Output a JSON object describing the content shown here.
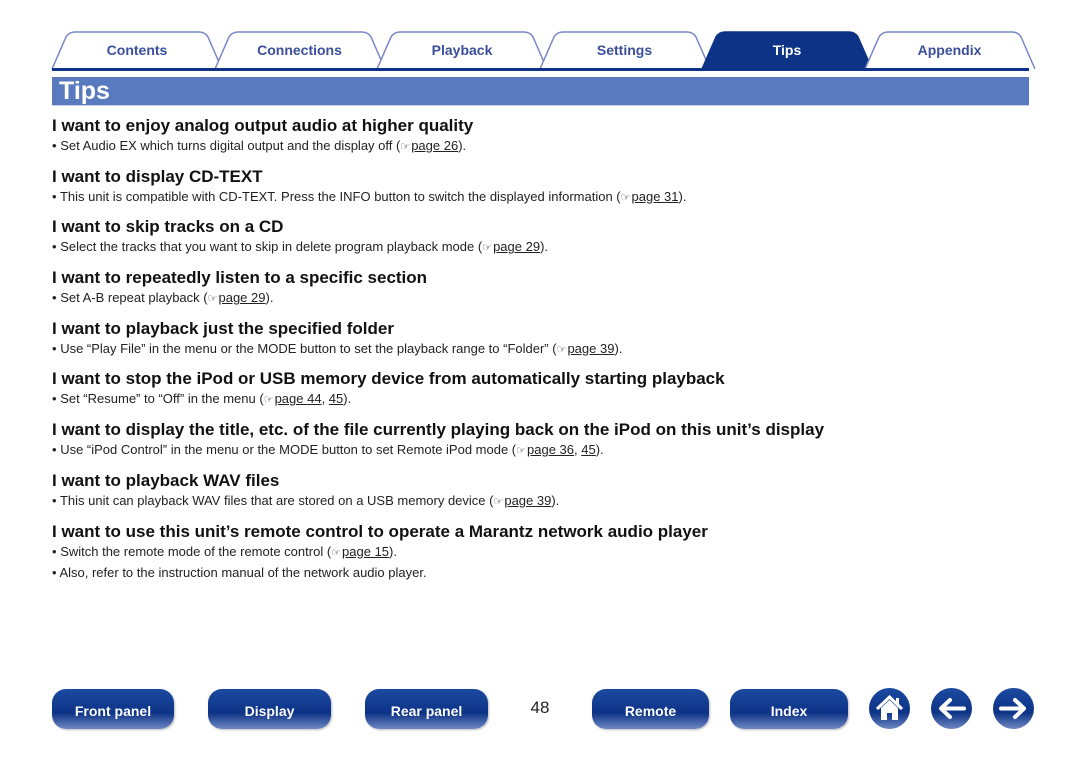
{
  "tabs": [
    {
      "label": "Contents"
    },
    {
      "label": "Connections"
    },
    {
      "label": "Playback"
    },
    {
      "label": "Settings"
    },
    {
      "label": "Tips",
      "active": true
    },
    {
      "label": "Appendix"
    }
  ],
  "title": "Tips",
  "sections": [
    {
      "heading": "I want to enjoy analog output audio at higher quality",
      "bullets": [
        {
          "pre": "Set Audio EX which turns digital output and the display off (",
          "links": [
            "page 26"
          ],
          "post": ")."
        }
      ]
    },
    {
      "heading": "I want to display CD-TEXT",
      "bullets": [
        {
          "pre": "This unit is compatible with CD-TEXT. Press the INFO button to switch the displayed information (",
          "links": [
            "page 31"
          ],
          "post": ")."
        }
      ]
    },
    {
      "heading": "I want to skip tracks on a CD",
      "bullets": [
        {
          "pre": "Select the tracks that you want to skip in delete program playback mode (",
          "links": [
            "page 29"
          ],
          "post": ")."
        }
      ]
    },
    {
      "heading": "I want to repeatedly listen to a specific section",
      "bullets": [
        {
          "pre": "Set A-B repeat playback (",
          "links": [
            "page 29"
          ],
          "post": ")."
        }
      ]
    },
    {
      "heading": "I want to playback just the specified folder",
      "bullets": [
        {
          "pre": "Use “Play File” in the menu or the MODE button to set the playback range to “Folder” (",
          "links": [
            "page 39"
          ],
          "post": ")."
        }
      ]
    },
    {
      "heading": "I want to stop the iPod or USB memory device from automatically starting playback",
      "bullets": [
        {
          "pre": "Set “Resume” to “Off” in the menu (",
          "links": [
            "page 44",
            "45"
          ],
          "post": ")."
        }
      ]
    },
    {
      "heading": "I want to display the title, etc. of the file currently playing back on the iPod on this unit’s display",
      "bullets": [
        {
          "pre": "Use “iPod Control” in the menu or the MODE button to set Remote iPod mode (",
          "links": [
            "page 36",
            "45"
          ],
          "post": ")."
        }
      ]
    },
    {
      "heading": "I want to playback WAV files",
      "bullets": [
        {
          "pre": "This unit can playback WAV files that are stored on a USB memory device (",
          "links": [
            "page 39"
          ],
          "post": ")."
        }
      ]
    },
    {
      "heading": "I want to use this unit’s remote control to operate a Marantz network audio player",
      "bullets": [
        {
          "pre": "Switch the remote mode of the remote control (",
          "links": [
            "page 15"
          ],
          "post": ")."
        },
        {
          "pre": "Also, refer to the instruction manual of the network audio player.",
          "links": [],
          "post": ""
        }
      ]
    }
  ],
  "page_ref_icon": "pointing-hand-icon",
  "bullet_char": "•",
  "link_separator": ", ",
  "page_number": "48",
  "footer": {
    "front_panel": "Front panel",
    "display": "Display",
    "rear_panel": "Rear panel",
    "remote": "Remote",
    "index": "Index",
    "home_icon": "home-icon",
    "back_icon": "arrow-left-icon",
    "forward_icon": "arrow-right-icon"
  },
  "colors": {
    "active_tab": "#0d3386",
    "tab_outline": "#7a86c4",
    "title_bar": "#5a7abf",
    "tab_text": "#3a4f9c"
  }
}
